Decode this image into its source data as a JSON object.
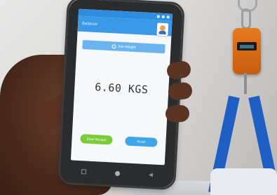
{
  "app": {
    "title": "Balance"
  },
  "controls": {
    "get_weight_label": "Get Weight",
    "scale_icon": "scale-icon"
  },
  "reading": {
    "weight_text": "6.60 KGS"
  },
  "buttons": {
    "left_label": "Enter Receipt",
    "right_label": "Finish"
  },
  "colors": {
    "app_bar": "#3a9ae8",
    "status_bar": "#2f8de0",
    "get_weight_button": "#6ab4f0",
    "left_button": "#7ccc3a",
    "right_button": "#3fa7e8",
    "hanging_scale": "#e67a1f",
    "bag_strap": "#1f5fc4"
  }
}
